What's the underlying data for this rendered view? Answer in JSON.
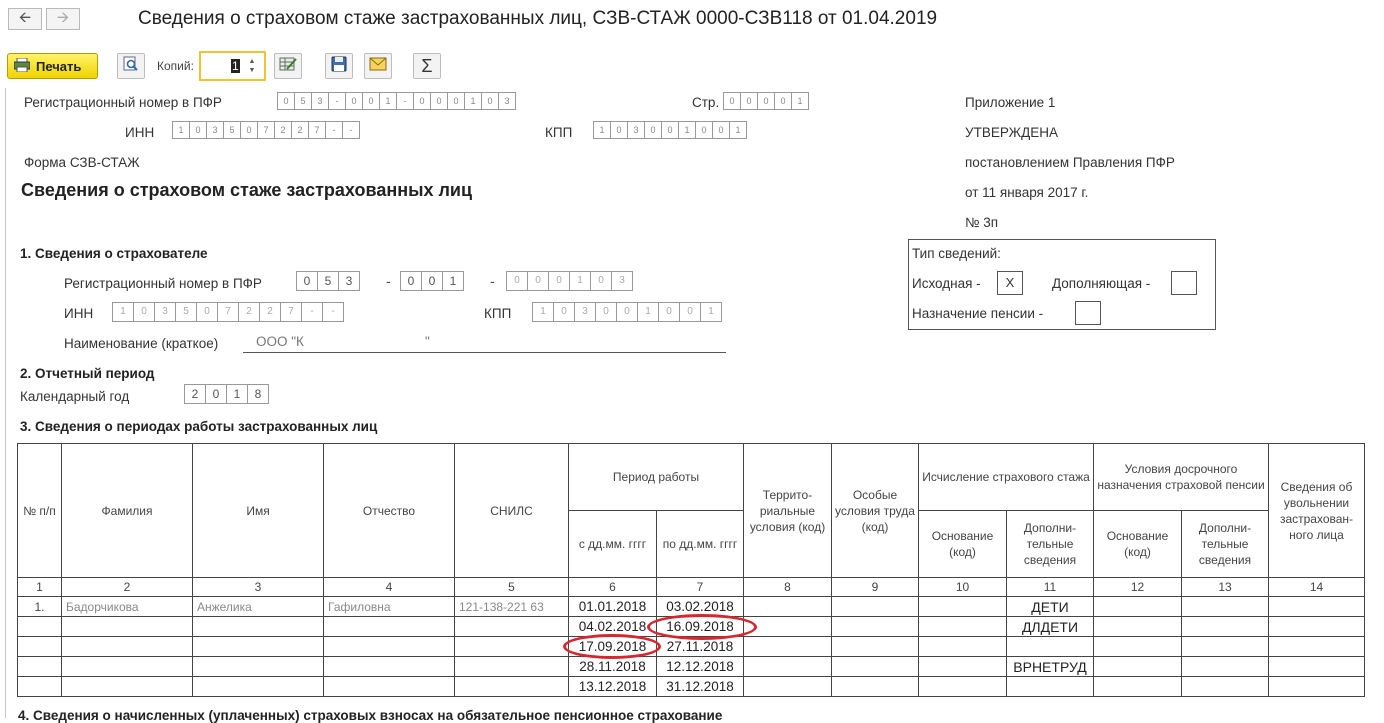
{
  "window": {
    "title": "Сведения о страховом стаже застрахованных лиц, СЗВ-СТАЖ 0000-СЗВ118 от 01.04.2019",
    "back_icon": "arrow-left-icon",
    "forward_icon": "arrow-right-icon"
  },
  "toolbar": {
    "print_label": "Печать",
    "copies_label": "Копий:",
    "copies_value": "1"
  },
  "header": {
    "reg_label": "Регистрационный номер в ПФР",
    "reg_cells": [
      "0",
      "5",
      "3",
      "-",
      "0",
      "0",
      "1",
      "-",
      "0",
      "0",
      "0",
      "1",
      "0",
      "3"
    ],
    "page_label": "Стр.",
    "page_cells": [
      "0",
      "0",
      "0",
      "0",
      "1"
    ],
    "inn_label": "ИНН",
    "inn_cells": [
      "1",
      "0",
      "3",
      "5",
      "0",
      "7",
      "2",
      "2",
      "7",
      "-",
      "-"
    ],
    "kpp_label": "КПП",
    "kpp_cells": [
      "1",
      "0",
      "3",
      "0",
      "0",
      "1",
      "0",
      "0",
      "1"
    ],
    "form_label": "Форма СЗВ-СТАЖ",
    "main_title": "Сведения о страховом стаже застрахованных лиц",
    "approval": [
      "Приложение 1",
      "УТВЕРЖДЕНА",
      "постановлением Правления ПФР",
      "от 11 января 2017 г.",
      "№ 3п"
    ]
  },
  "section1": {
    "title": "1. Сведения о страхователе",
    "reg_label": "Регистрационный номер в ПФР",
    "reg_part1": [
      "0",
      "5",
      "3"
    ],
    "reg_part2": [
      "0",
      "0",
      "1"
    ],
    "reg_part3": [
      "0",
      "0",
      "0",
      "1",
      "0",
      "3"
    ],
    "inn_label": "ИНН",
    "inn_cells": [
      "1",
      "0",
      "3",
      "5",
      "0",
      "7",
      "2",
      "2",
      "7",
      "-",
      "-"
    ],
    "kpp_label": "КПП",
    "kpp_cells": [
      "1",
      "0",
      "3",
      "0",
      "0",
      "1",
      "0",
      "0",
      "1"
    ],
    "name_label": "Наименование (краткое)",
    "name_value": "ООО \"К",
    "name_tail": "\""
  },
  "info_type": {
    "title": "Тип сведений:",
    "initial_label": "Исходная -",
    "initial_value": "X",
    "supplement_label": "Дополняющая -",
    "pension_label": "Назначение пенсии -"
  },
  "section2": {
    "title": "2. Отчетный период",
    "year_label": "Календарный год",
    "year_cells": [
      "2",
      "0",
      "1",
      "8"
    ]
  },
  "section3": {
    "title": "3. Сведения о периодах работы застрахованных лиц",
    "headers": {
      "num": "№ п/п",
      "surname": "Фамилия",
      "name": "Имя",
      "patronymic": "Отчество",
      "snils": "СНИЛС",
      "period": "Период работы",
      "from": "с дд.мм. гггг",
      "to": "по дд.мм. гггг",
      "territorial": "Террито-риальные условия (код)",
      "special": "Особые условия труда (код)",
      "calc": "Исчисление страхового стажа",
      "early": "Условия досрочного назначения страховой пенсии",
      "basis": "Основание (код)",
      "additional": "Дополни-тельные сведения",
      "dismissal": "Сведения об увольнении застрахован-ного лица"
    },
    "col_numbers": [
      "1",
      "2",
      "3",
      "4",
      "5",
      "6",
      "7",
      "8",
      "9",
      "10",
      "11",
      "12",
      "13",
      "14"
    ],
    "rows": [
      {
        "num": "1.",
        "surname": "Бадорчикова",
        "name": "Анжелика",
        "patronymic": "Гафиловна",
        "snils": "121-138-221 63",
        "from": "01.01.2018",
        "to": "03.02.2018",
        "note": "ДЕТИ"
      },
      {
        "num": "",
        "surname": "",
        "name": "",
        "patronymic": "",
        "snils": "",
        "from": "04.02.2018",
        "to": "16.09.2018",
        "note": "ДЛДЕТИ"
      },
      {
        "num": "",
        "surname": "",
        "name": "",
        "patronymic": "",
        "snils": "",
        "from": "17.09.2018",
        "to": "27.11.2018",
        "note": ""
      },
      {
        "num": "",
        "surname": "",
        "name": "",
        "patronymic": "",
        "snils": "",
        "from": "28.11.2018",
        "to": "12.12.2018",
        "note": "ВРНЕТРУД"
      },
      {
        "num": "",
        "surname": "",
        "name": "",
        "patronymic": "",
        "snils": "",
        "from": "13.12.2018",
        "to": "31.12.2018",
        "note": ""
      }
    ]
  },
  "section4": {
    "title": "4. Сведения о начисленных (уплаченных) страховых взносах на обязательное пенсионное страхование"
  },
  "colors": {
    "highlight_oval": "#d7262e",
    "print_button": "#f5dc14",
    "copies_border": "#f2c230"
  }
}
